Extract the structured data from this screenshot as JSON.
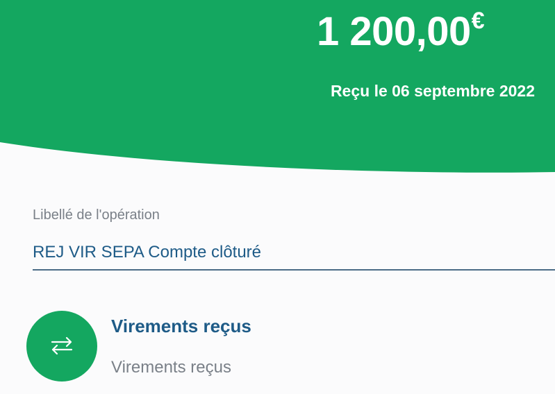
{
  "colors": {
    "brand_green": "#14a760",
    "label_gray": "#7a8088",
    "value_blue": "#1e5b87",
    "underline": "#4a6c86"
  },
  "transaction": {
    "amount": "1 200,00",
    "currency": "€",
    "date_text": "Reçu le 06 septembre 2022"
  },
  "operation_field": {
    "label": "Libellé de l'opération",
    "value": "REJ VIR SEPA Compte clôturé"
  },
  "category": {
    "icon": "transfer-arrows-icon",
    "title": "Virements reçus",
    "subtitle": "Virements reçus"
  }
}
